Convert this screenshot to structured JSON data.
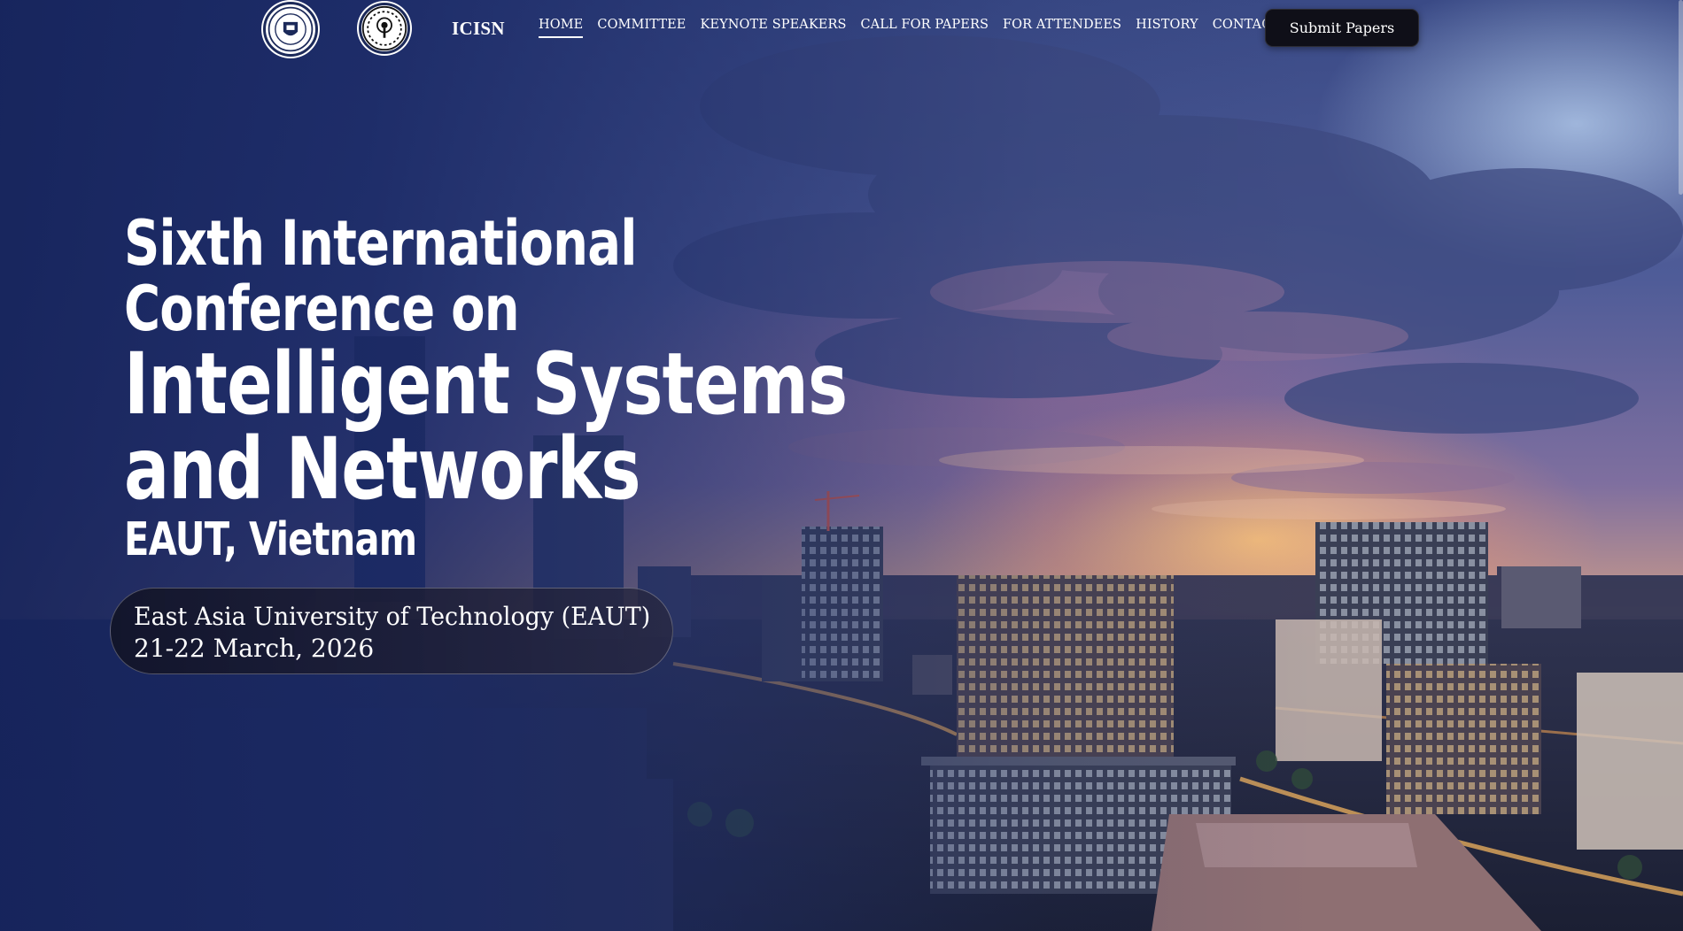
{
  "header": {
    "logos": [
      {
        "name": "eaut-logo",
        "text": "EAUT"
      },
      {
        "name": "icisn-logo",
        "text": "ICISN"
      }
    ],
    "brand": "ICISN",
    "menu": [
      {
        "label": "HOME",
        "active": true
      },
      {
        "label": "COMMITTEE",
        "active": false
      },
      {
        "label": "KEYNOTE SPEAKERS",
        "active": false
      },
      {
        "label": "CALL FOR PAPERS",
        "active": false
      },
      {
        "label": "FOR ATTENDEES",
        "active": false
      },
      {
        "label": "HISTORY",
        "active": false
      },
      {
        "label": "CONTACT US",
        "active": false
      }
    ],
    "submit_label": "Submit Papers"
  },
  "hero": {
    "title_line1": "Sixth International",
    "title_line2": "Conference on",
    "title_line3": "Intelligent Systems",
    "title_line4": "and Networks",
    "location": "EAUT, Vietnam",
    "venue": "East Asia University of Technology (EAUT)",
    "dates": "21-22 March, 2026"
  },
  "colors": {
    "overlay_blue": "#1a2a66",
    "button_bg": "#0f0f18",
    "text": "#ffffff"
  }
}
